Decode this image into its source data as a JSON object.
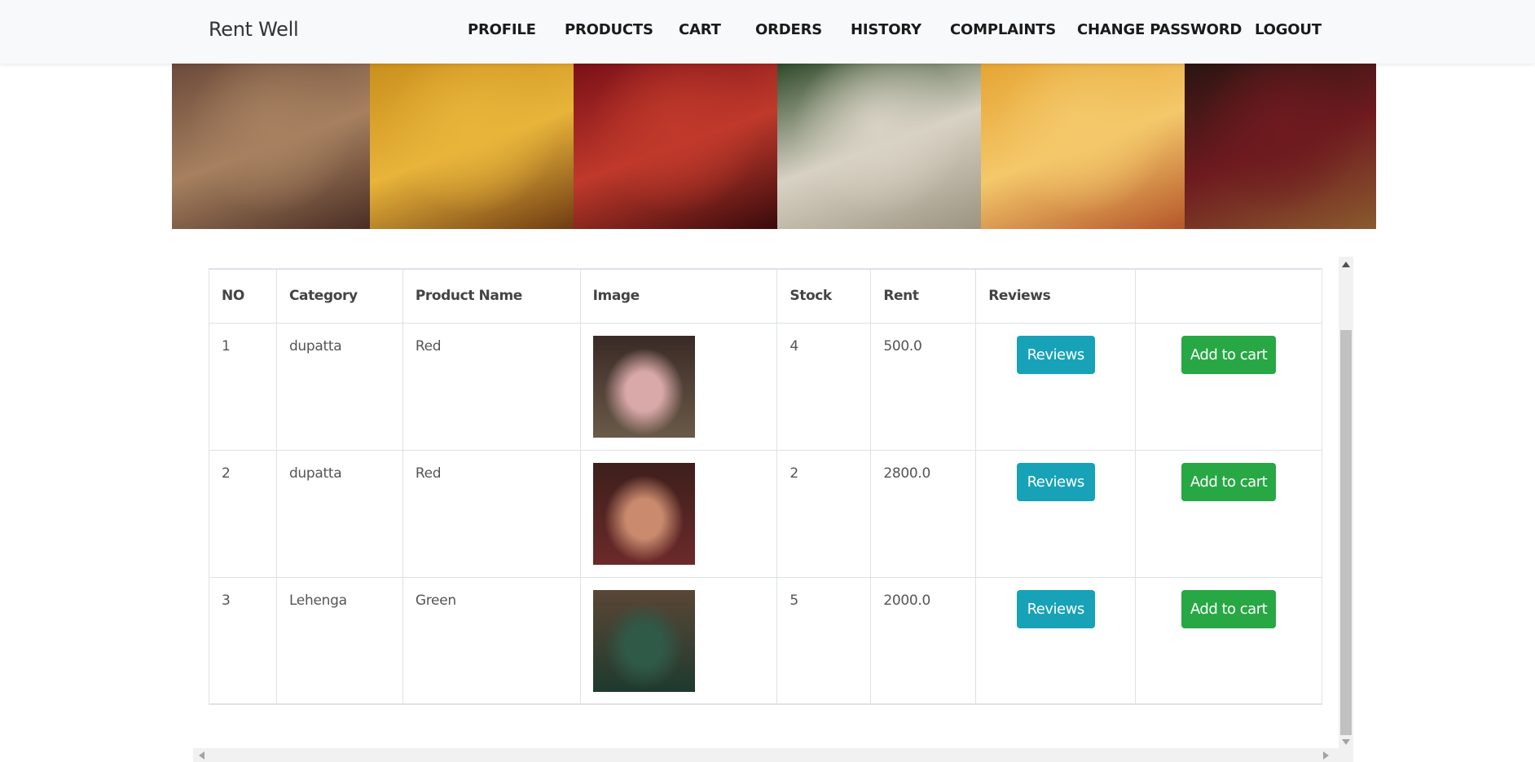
{
  "app": {
    "brand": "Rent Well"
  },
  "nav": {
    "items": [
      {
        "label": "PROFILE",
        "name": "nav-profile"
      },
      {
        "label": "PRODUCTS",
        "name": "nav-products"
      },
      {
        "label": "CART",
        "name": "nav-cart"
      },
      {
        "label": "ORDERS",
        "name": "nav-orders"
      },
      {
        "label": "HISTORY",
        "name": "nav-history"
      },
      {
        "label": "COMPLAINTS",
        "name": "nav-complaints"
      },
      {
        "label": "CHANGE PASSWORD",
        "name": "nav-change-password"
      },
      {
        "label": "LOGOUT",
        "name": "nav-logout"
      }
    ]
  },
  "banner": {
    "tiles": [
      {
        "name": "banner-image-saree-gold",
        "colors": [
          "#6b4a3a",
          "#a6805f",
          "#4a2e24"
        ]
      },
      {
        "name": "banner-image-yellow-lehenga",
        "colors": [
          "#c9901d",
          "#e8b43a",
          "#6f3b12"
        ]
      },
      {
        "name": "banner-image-red-bridal",
        "colors": [
          "#7a1018",
          "#c0392b",
          "#3a0a0c"
        ]
      },
      {
        "name": "banner-image-white-lehenga",
        "colors": [
          "#2f4a2a",
          "#d8d2c4",
          "#9c9381"
        ]
      },
      {
        "name": "banner-image-yellow-skirt",
        "colors": [
          "#e6a534",
          "#f4c86a",
          "#b5562a"
        ]
      },
      {
        "name": "banner-image-maroon-bridal",
        "colors": [
          "#2a1512",
          "#6e1a1f",
          "#8a5a2e"
        ]
      }
    ]
  },
  "table": {
    "headers": [
      "NO",
      "Category",
      "Product Name",
      "Image",
      "Stock",
      "Rent",
      "Reviews",
      ""
    ],
    "rows": [
      {
        "no": "1",
        "category": "dupatta",
        "product": "Red",
        "image_colors": [
          "#3a2a26",
          "#d9a8a8",
          "#6a5a48"
        ],
        "stock": "4",
        "rent": "500.0"
      },
      {
        "no": "2",
        "category": "dupatta",
        "product": "Red",
        "image_colors": [
          "#3d1f1c",
          "#c98a6e",
          "#6b2a2a"
        ],
        "stock": "2",
        "rent": "2800.0"
      },
      {
        "no": "3",
        "category": "Lehenga",
        "product": "Green",
        "image_colors": [
          "#5a4636",
          "#2f5a48",
          "#1e3a2e"
        ],
        "stock": "5",
        "rent": "2000.0"
      }
    ],
    "reviews_label": "Reviews",
    "cart_label": "Add to cart"
  },
  "colors": {
    "reviews_button": "#17a2b8",
    "cart_button": "#28a745",
    "navbar": "#f8f9fa"
  }
}
